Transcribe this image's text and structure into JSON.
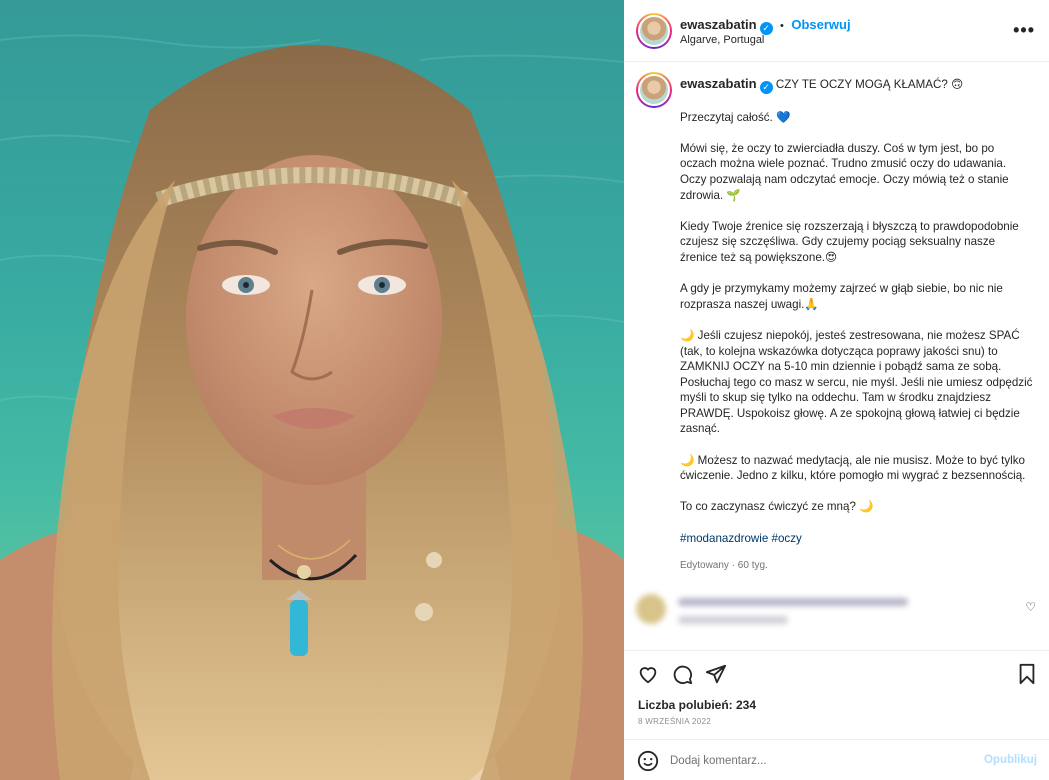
{
  "post": {
    "username": "ewaszabatin",
    "follow_label": "Obserwuj",
    "separator": "•",
    "location": "Algarve, Portugal",
    "more_label": "•••"
  },
  "caption": {
    "username": "ewaszabatin",
    "title": "CZY TE OCZY MOGĄ KŁAMAĆ? 🙃",
    "paragraphs": [
      "Przeczytaj całość. 💙",
      "Mówi się, że oczy to zwierciadła duszy. Coś w tym jest, bo po oczach można wiele poznać. Trudno zmusić oczy do udawania. Oczy pozwalają nam odczytać emocje. Oczy mówią też o stanie zdrowia. 🌱",
      "Kiedy Twoje źrenice się rozszerzają i błyszczą to prawdopodobnie czujesz się szczęśliwa. Gdy czujemy pociąg seksualny nasze źrenice też są powiększone.😍",
      "A gdy je przymykamy możemy zajrzeć w głąb siebie, bo nic nie rozprasza naszej uwagi.🙏",
      "🌙 Jeśli czujesz niepokój, jesteś zestresowana, nie możesz SPAĆ (tak, to kolejna wskazówka dotycząca poprawy jakości snu) to ZAMKNIJ OCZY na 5-10 min dziennie i pobądź sama ze sobą. Posłuchaj tego co masz w sercu, nie myśl. Jeśli nie umiesz odpędzić myśli to skup się tylko na oddechu. Tam w środku znajdziesz PRAWDĘ. Uspokoisz głowę. A ze spokojną głową łatwiej ci będzie zasnąć.",
      "🌙 Możesz to nazwać medytacją, ale nie musisz. Może to być tylko ćwiczenie. Jedno z kilku, które pomogło mi wygrać z bezsennością.",
      "To co zaczynasz ćwiczyć ze mną? 🌙"
    ],
    "hashtags": "#modanazdrowie #oczy",
    "meta": "Edytowany · 60 tyg."
  },
  "actions": {
    "like_icon": "heart-icon",
    "comment_icon": "comment-icon",
    "share_icon": "share-icon",
    "save_icon": "bookmark-icon",
    "likes_text": "Liczba polubień: 234",
    "date": "8 WRZEŚNIA 2022"
  },
  "add_comment": {
    "placeholder": "Dodaj komentarz...",
    "publish_label": "Opublikuj",
    "emoji_icon": "emoji-icon"
  },
  "colors": {
    "accent": "#0095f6",
    "publish_disabled": "#b2dffc",
    "hashtag": "#00376b"
  }
}
